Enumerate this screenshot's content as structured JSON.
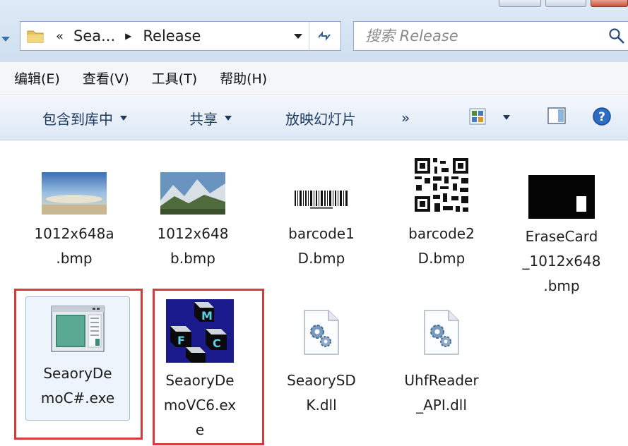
{
  "address": {
    "crumbs": [
      "Sea...",
      "Release"
    ],
    "chevron": "«",
    "folder_icon": "folder-icon"
  },
  "search": {
    "placeholder": "搜索 Release"
  },
  "menu": {
    "items": [
      "编辑(E)",
      "查看(V)",
      "工具(T)",
      "帮助(H)"
    ]
  },
  "commands": {
    "include_library": "包含到库中",
    "share": "共享",
    "slideshow": "放映幻灯片",
    "more": "»"
  },
  "files": [
    {
      "name": "1012x648a\n.bmp",
      "icon": "image-sky-icon"
    },
    {
      "name": "1012x648\nb.bmp",
      "icon": "image-mountain-icon"
    },
    {
      "name": "barcode1\nD.bmp",
      "icon": "barcode-icon"
    },
    {
      "name": "barcode2\nD.bmp",
      "icon": "qrcode-icon"
    },
    {
      "name": "EraseCard\n_1012x648\n.bmp",
      "icon": "black-card-icon"
    },
    {
      "name": "SeaoryDe\nmoC#.exe",
      "icon": "app-window-icon"
    },
    {
      "name": "SeaoryDe\nmoVC6.ex\ne",
      "icon": "mfc-cubes-icon"
    },
    {
      "name": "SeaorySD\nK.dll",
      "icon": "dll-gear-icon"
    },
    {
      "name": "UhfReader\n_API.dll",
      "icon": "dll-gear-icon"
    }
  ],
  "colors": {
    "highlight_box": "#d63b3b",
    "toolbar_bg": "#dde8f5"
  }
}
